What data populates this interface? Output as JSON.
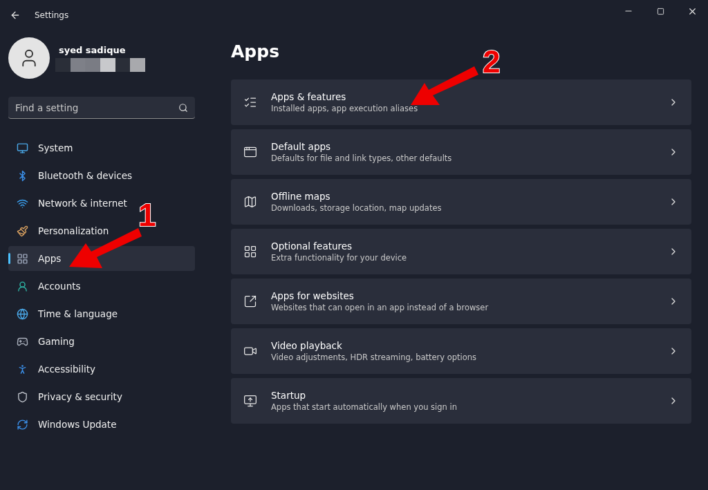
{
  "window": {
    "title": "Settings"
  },
  "user": {
    "name": "syed sadique"
  },
  "search": {
    "placeholder": "Find a setting"
  },
  "nav": [
    {
      "label": "System",
      "selected": false
    },
    {
      "label": "Bluetooth & devices",
      "selected": false
    },
    {
      "label": "Network & internet",
      "selected": false
    },
    {
      "label": "Personalization",
      "selected": false
    },
    {
      "label": "Apps",
      "selected": true
    },
    {
      "label": "Accounts",
      "selected": false
    },
    {
      "label": "Time & language",
      "selected": false
    },
    {
      "label": "Gaming",
      "selected": false
    },
    {
      "label": "Accessibility",
      "selected": false
    },
    {
      "label": "Privacy & security",
      "selected": false
    },
    {
      "label": "Windows Update",
      "selected": false
    }
  ],
  "page": {
    "title": "Apps"
  },
  "cards": [
    {
      "title": "Apps & features",
      "subtitle": "Installed apps, app execution aliases"
    },
    {
      "title": "Default apps",
      "subtitle": "Defaults for file and link types, other defaults"
    },
    {
      "title": "Offline maps",
      "subtitle": "Downloads, storage location, map updates"
    },
    {
      "title": "Optional features",
      "subtitle": "Extra functionality for your device"
    },
    {
      "title": "Apps for websites",
      "subtitle": "Websites that can open in an app instead of a browser"
    },
    {
      "title": "Video playback",
      "subtitle": "Video adjustments, HDR streaming, battery options"
    },
    {
      "title": "Startup",
      "subtitle": "Apps that start automatically when you sign in"
    }
  ],
  "annotations": [
    "1",
    "2"
  ]
}
